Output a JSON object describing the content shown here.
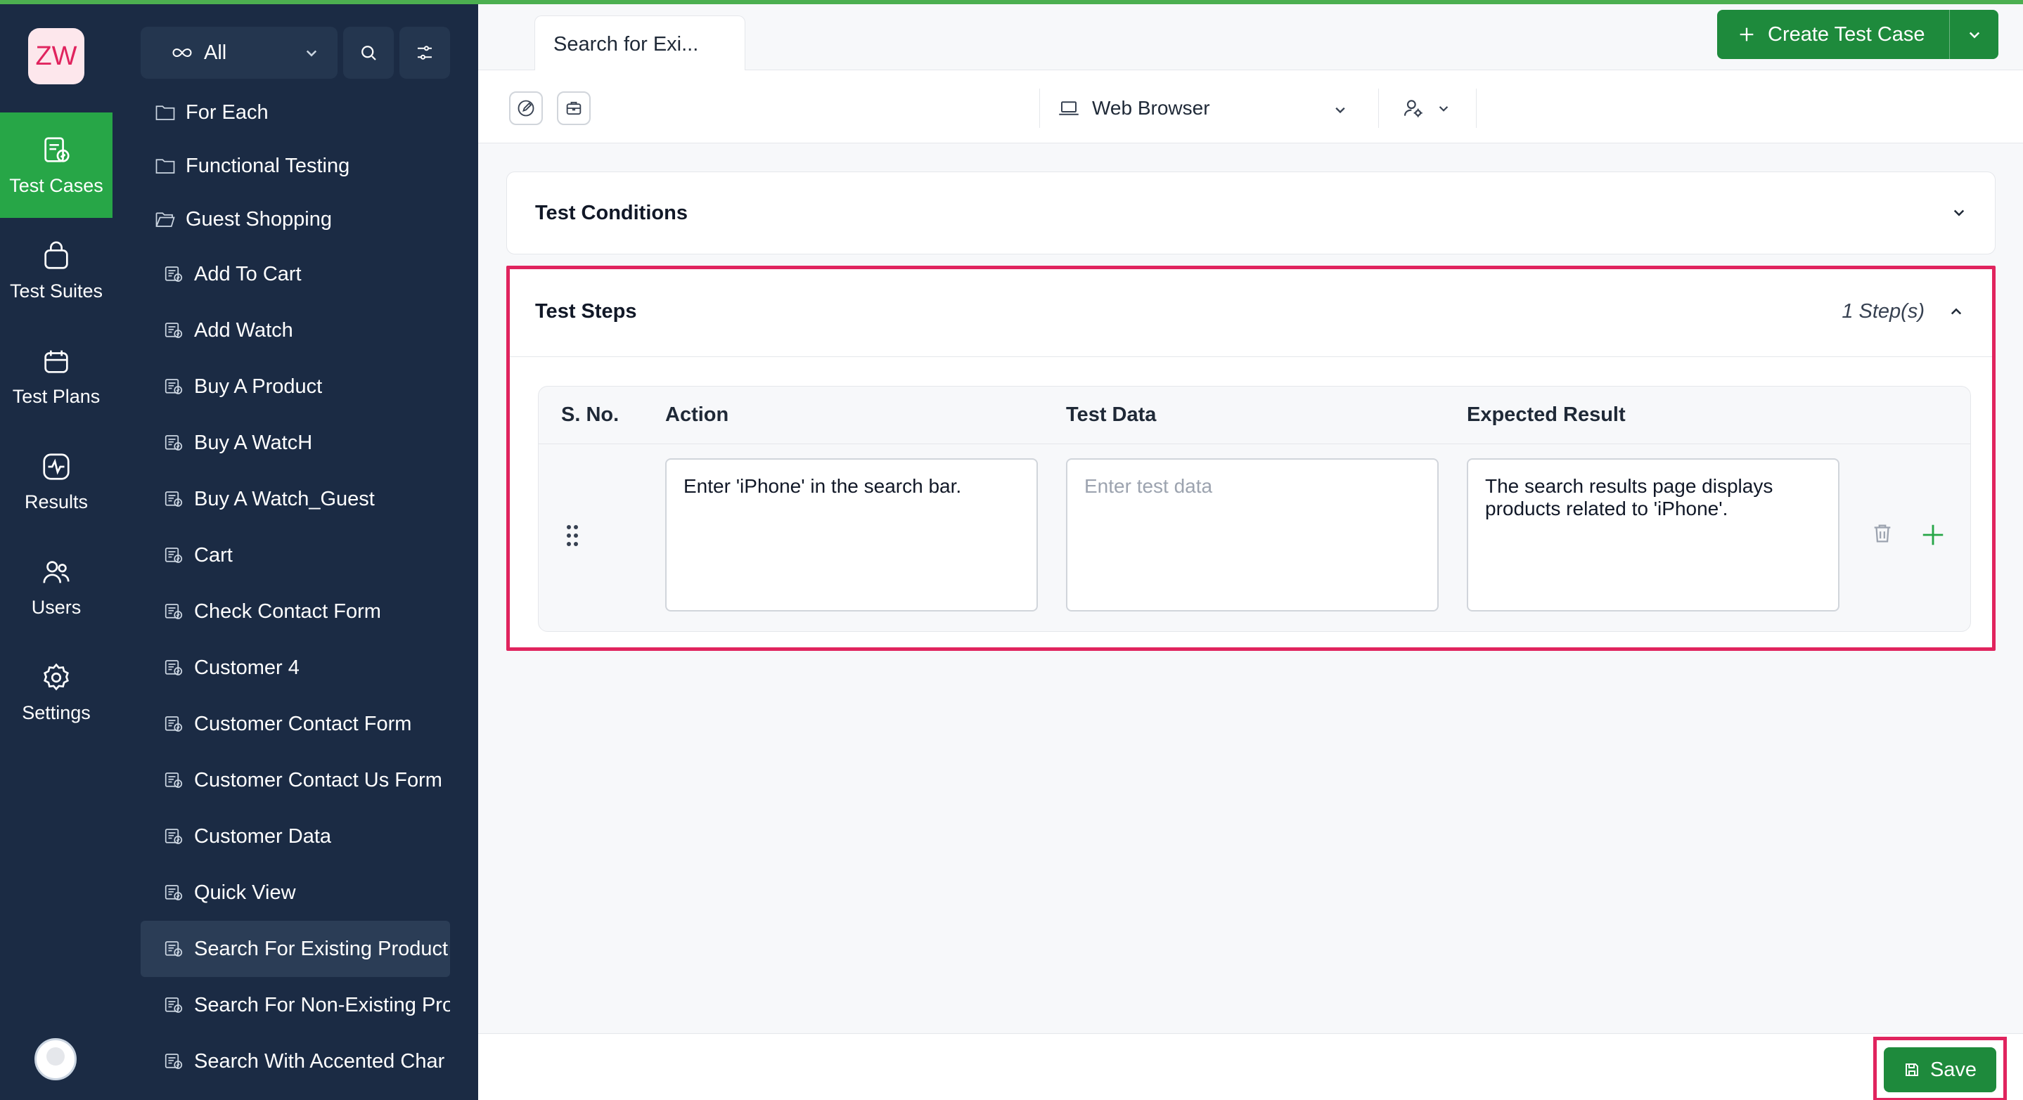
{
  "app": {
    "logo_text": "ZW",
    "accent": "#27a647",
    "highlight": "#e0245e"
  },
  "rail": {
    "items": [
      {
        "label": "Test Cases",
        "icon": "test-cases-icon",
        "active": true
      },
      {
        "label": "Test Suites",
        "icon": "test-suites-icon",
        "active": false
      },
      {
        "label": "Test Plans",
        "icon": "test-plans-icon",
        "active": false
      },
      {
        "label": "Results",
        "icon": "results-icon",
        "active": false
      },
      {
        "label": "Users",
        "icon": "users-icon",
        "active": false
      },
      {
        "label": "Settings",
        "icon": "gear-icon",
        "active": false
      }
    ]
  },
  "tree": {
    "filter_label": "All",
    "folders": [
      {
        "label": "For Each"
      },
      {
        "label": "Functional Testing"
      },
      {
        "label": "Guest Shopping"
      }
    ],
    "cases": [
      {
        "label": "Add To Cart"
      },
      {
        "label": "Add Watch"
      },
      {
        "label": "Buy A Product"
      },
      {
        "label": "Buy A WatcH"
      },
      {
        "label": "Buy A Watch_Guest"
      },
      {
        "label": "Cart"
      },
      {
        "label": "Check Contact Form"
      },
      {
        "label": "Customer 4"
      },
      {
        "label": "Customer Contact Form"
      },
      {
        "label": "Customer Contact Us Form"
      },
      {
        "label": "Customer Data"
      },
      {
        "label": "Quick View"
      },
      {
        "label": "Search For Existing Product"
      },
      {
        "label": "Search For Non-Existing Pro"
      },
      {
        "label": "Search With Accented Char"
      }
    ]
  },
  "tab": {
    "label": "Search for Exi..."
  },
  "header": {
    "create_label": "Create Test Case"
  },
  "toolbar": {
    "browser_label": "Web Browser"
  },
  "conditions": {
    "title": "Test Conditions"
  },
  "steps": {
    "title": "Test Steps",
    "count": "1 Step(s)",
    "columns": {
      "sno": "S. No.",
      "action": "Action",
      "data": "Test Data",
      "expected": "Expected Result"
    },
    "rows": [
      {
        "action": "Enter 'iPhone' in the search bar.",
        "data_placeholder": "Enter test data",
        "expected": "The search results page displays products related to 'iPhone'."
      }
    ]
  },
  "footer": {
    "save_label": "Save"
  }
}
